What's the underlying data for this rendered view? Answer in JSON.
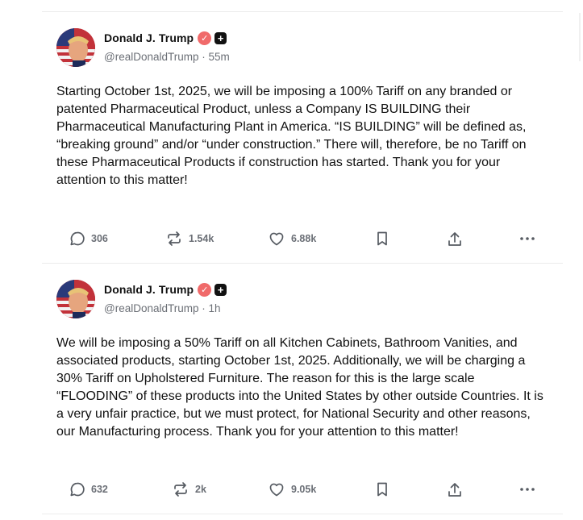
{
  "posts": [
    {
      "author": "Donald J. Trump",
      "handle": "@realDonaldTrump",
      "separator": "·",
      "time": "55m",
      "text": "Starting October 1st, 2025, we will be imposing a 100% Tariff on any branded or patented Pharmaceutical Product, unless a Company IS BUILDING their Pharmaceutical Manufacturing Plant in America. “IS BUILDING” will be defined as, “breaking ground” and/or “under construction.” There will, therefore, be no Tariff on these Pharmaceutical Products if construction has started. Thank you for your attention to this matter!",
      "replies": "306",
      "reposts": "1.54k",
      "likes": "6.88k"
    },
    {
      "author": "Donald J. Trump",
      "handle": "@realDonaldTrump",
      "separator": "·",
      "time": "1h",
      "text": "We will be imposing a 50% Tariff on all Kitchen Cabinets, Bathroom Vanities, and associated products, starting October 1st, 2025. Additionally, we will be charging a 30% Tariff on Upholstered Furniture. The reason for this is the large scale “FLOODING” of these products into the United States by other outside Countries. It is a very unfair practice, but we must protect, for National Security and other reasons, our Manufacturing process. Thank you for your attention to this matter!",
      "replies": "632",
      "reposts": "2k",
      "likes": "9.05k"
    }
  ],
  "icons": {
    "reply": "speech-bubble-icon",
    "repost": "repost-arrows-icon",
    "like": "heart-icon",
    "bookmark": "bookmark-icon",
    "share": "share-upload-icon",
    "more": "more-dots-icon",
    "verified": "verified-badge-icon",
    "plus": "plus-badge-icon"
  },
  "colors": {
    "verified": "#f06a6a",
    "text": "#111111",
    "muted": "#6b6f76",
    "divider": "#ececec"
  }
}
